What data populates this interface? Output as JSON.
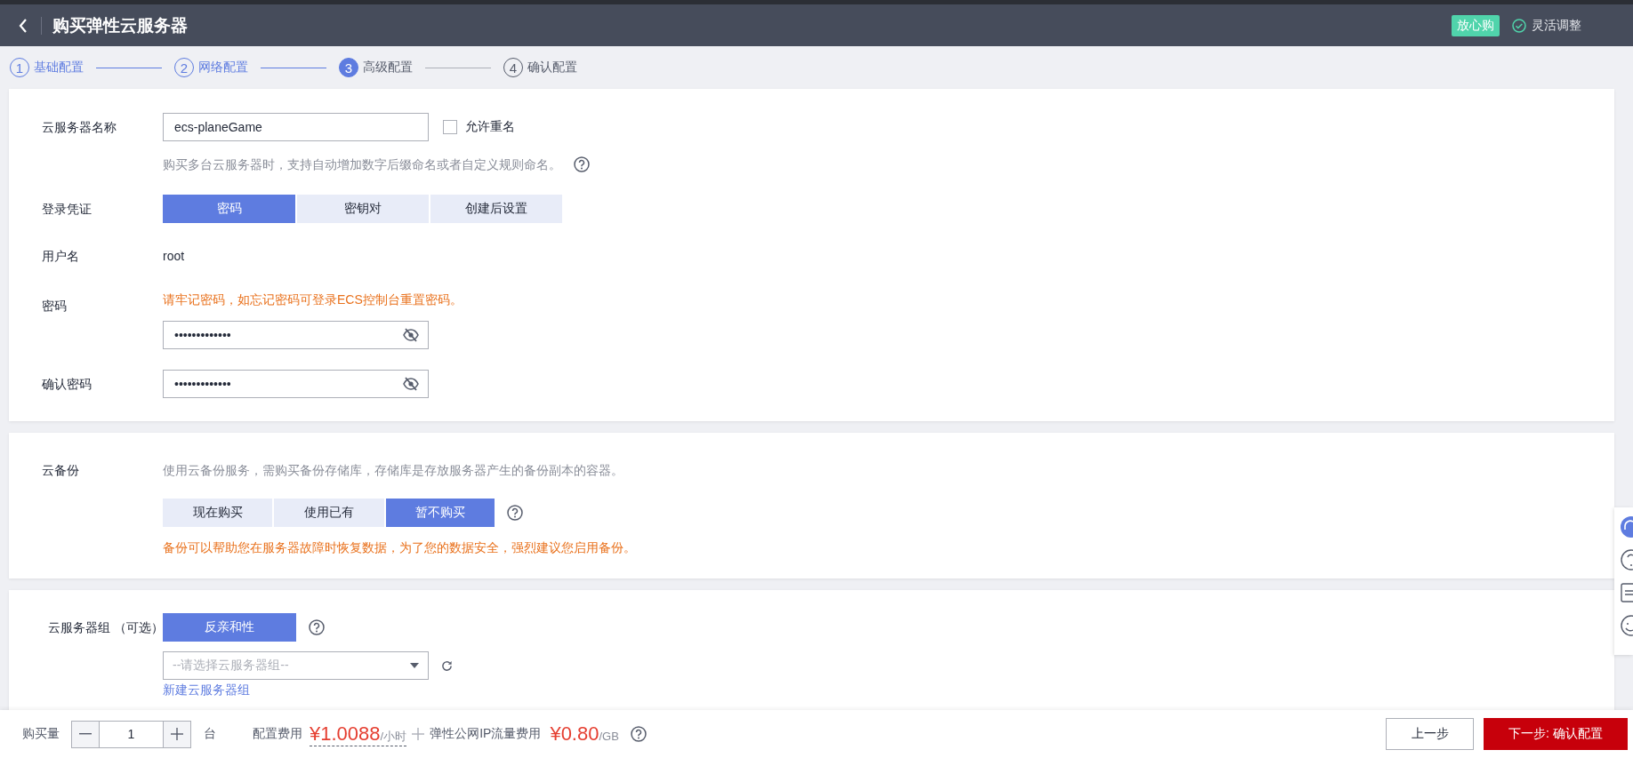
{
  "header": {
    "title": "购买弹性云服务器",
    "badge": "放心购",
    "feature": "灵活调整"
  },
  "steps": [
    {
      "number": "1",
      "label": "基础配置",
      "completed": true,
      "selected": false
    },
    {
      "number": "2",
      "label": "网络配置",
      "completed": true,
      "selected": false
    },
    {
      "number": "3",
      "label": "高级配置",
      "completed": false,
      "selected": true
    },
    {
      "number": "4",
      "label": "确认配置",
      "completed": false,
      "selected": false
    }
  ],
  "basic": {
    "name": {
      "label": "云服务器名称",
      "value": "ecs-planeGame",
      "allow_duplicate": {
        "label": "允许重名",
        "checked": false
      },
      "hint": "购买多台云服务器时，支持自动增加数字后缀命名或者自定义规则命名。"
    },
    "credential": {
      "label": "登录凭证",
      "options": [
        {
          "label": "密码",
          "selected": true
        },
        {
          "label": "密钥对",
          "selected": false
        },
        {
          "label": "创建后设置",
          "selected": false
        }
      ]
    },
    "username": {
      "label": "用户名",
      "value": "root"
    },
    "password": {
      "label": "密码",
      "warning": "请牢记密码，如忘记密码可登录ECS控制台重置密码。",
      "value": "•••••••••••••"
    },
    "confirm": {
      "label": "确认密码",
      "value": "•••••••••••••"
    }
  },
  "backup": {
    "label": "云备份",
    "description": "使用云备份服务，需购买备份存储库，存储库是存放服务器产生的备份副本的容器。",
    "options": [
      {
        "label": "现在购买",
        "selected": false
      },
      {
        "label": "使用已有",
        "selected": false
      },
      {
        "label": "暂不购买",
        "selected": true
      }
    ],
    "warning": "备份可以帮助您在服务器故障时恢复数据，为了您的数据安全，强烈建议您启用备份。"
  },
  "group": {
    "label": "云服务器组 （可选）",
    "options": [
      {
        "label": "反亲和性",
        "selected": true
      }
    ],
    "placeholder": "--请选择云服务器组--",
    "link": "新建云服务器组"
  },
  "footer": {
    "quantity_label": "购买量",
    "quantity": "1",
    "unit": "台",
    "config_fee_label": "配置费用",
    "config_fee": "¥1.0088",
    "config_fee_unit": "/小时",
    "ip_fee_label": "弹性公网IP流量费用",
    "ip_fee": "¥0.80",
    "ip_fee_unit": "/GB",
    "buttons": [
      {
        "label": "上一步",
        "kind": "secondary"
      },
      {
        "label": "下一步: 确认配置",
        "kind": "primary"
      }
    ]
  }
}
